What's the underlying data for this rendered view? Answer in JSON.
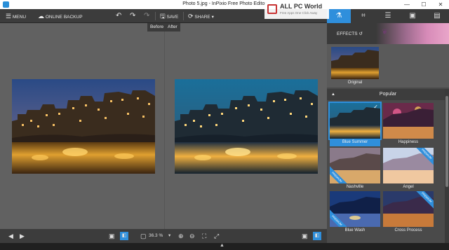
{
  "window": {
    "title": "Photo 5.jpg - InPixio Free Photo Editor",
    "controls": {
      "minimize": "—",
      "maximize": "☐",
      "close": "✕"
    }
  },
  "toolbar": {
    "menu_label": "MENU",
    "backup_label": "ONLINE BACKUP",
    "undo_icon": "↶",
    "redo_icon": "↷",
    "redo_all_icon": "↷",
    "save_label": "SAVE",
    "share_label": "SHARE"
  },
  "side_tabs": [
    {
      "icon": "flask-icon",
      "glyph": "⚗"
    },
    {
      "icon": "crop-icon",
      "glyph": "⌗"
    },
    {
      "icon": "sliders-icon",
      "glyph": "☰"
    },
    {
      "icon": "layers-icon",
      "glyph": "▣"
    },
    {
      "icon": "gallery-icon",
      "glyph": "▤"
    }
  ],
  "editor": {
    "before_label": "Before",
    "after_label": "After"
  },
  "watermark": {
    "title": "ALL PC World",
    "subtitle": "Free Apps One Click Away"
  },
  "bottom_bar": {
    "prev_icon": "◀",
    "next_icon": "▶",
    "zoom_value": "36.3 %",
    "zoom_caret": "▾",
    "zoom_in": "⊕",
    "zoom_out": "⊖",
    "fit": "⛶",
    "actual": "⤢"
  },
  "panel": {
    "effects_label": "EFFECTS",
    "effects_back": "↺",
    "original_label": "Original",
    "section_title": "Popular",
    "premium_badge": "PREMIUM",
    "selected_check": "✓",
    "effects": [
      {
        "name": "Blue Summer",
        "selected": true,
        "premium": false
      },
      {
        "name": "Happiness",
        "selected": false,
        "premium": false
      },
      {
        "name": "Nashville",
        "selected": false,
        "premium": true
      },
      {
        "name": "Angel",
        "selected": false,
        "premium": true
      },
      {
        "name": "Blue Wash",
        "selected": false,
        "premium": true
      },
      {
        "name": "Cross Process",
        "selected": false,
        "premium": true
      }
    ]
  },
  "colors": {
    "accent": "#2f8fdc",
    "toolbar": "#3c3c3c",
    "canvas": "#616161"
  }
}
